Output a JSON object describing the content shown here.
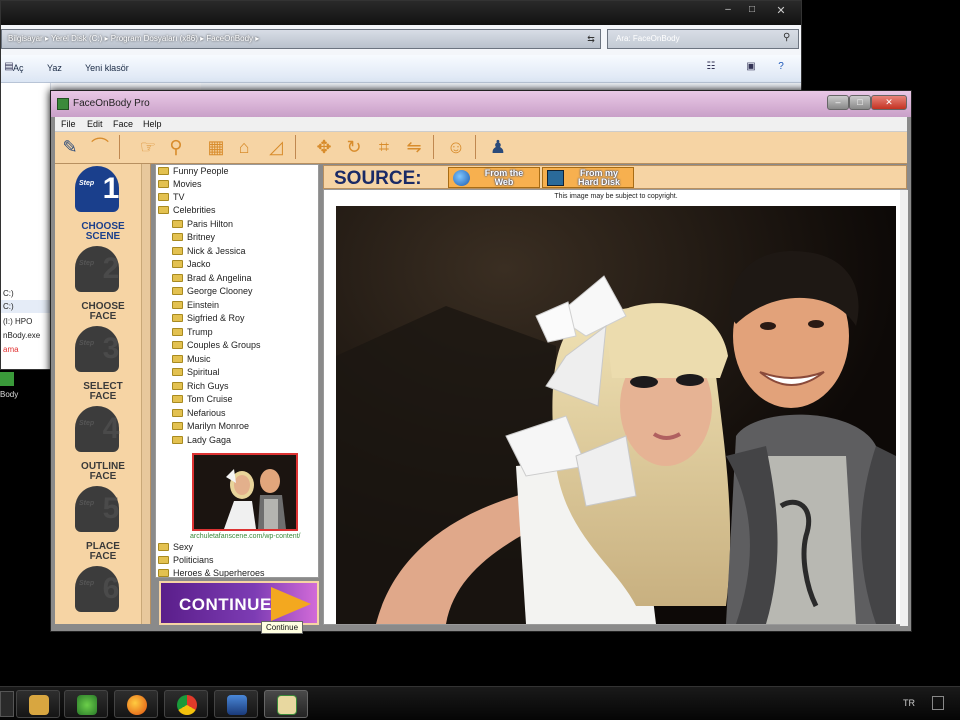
{
  "explorer": {
    "address_path": "Bilgisayar  ▸  Yerel Disk (C:)  ▸  Program Dosyaları (x86)  ▸  FaceOnBody  ▸",
    "search_placeholder": "Ara: FaceOnBody",
    "toolbar": [
      "Aç",
      "Yaz",
      "Yeni klasör"
    ],
    "nav_items": [
      "C:)",
      "C:)",
      "(I:) HPO",
      "nBody.exe",
      "ama"
    ],
    "desktop_label": "Body"
  },
  "app": {
    "title": "FaceOnBody Pro",
    "menu": [
      "File",
      "Edit",
      "Face",
      "Help"
    ],
    "steps": [
      {
        "word": "Step",
        "number": "1",
        "label_line1": "CHOOSE",
        "label_line2": "SCENE",
        "active": true
      },
      {
        "word": "Step",
        "number": "2",
        "label_line1": "CHOOSE",
        "label_line2": "FACE",
        "active": false
      },
      {
        "word": "Step",
        "number": "3",
        "label_line1": "SELECT",
        "label_line2": "FACE",
        "active": false
      },
      {
        "word": "Step",
        "number": "4",
        "label_line1": "OUTLINE",
        "label_line2": "FACE",
        "active": false
      },
      {
        "word": "Step",
        "number": "5",
        "label_line1": "PLACE",
        "label_line2": "FACE",
        "active": false
      },
      {
        "word": "Step",
        "number": "6",
        "label_line1": "",
        "label_line2": "",
        "active": false
      }
    ],
    "tree": {
      "top_level_before": [
        "Funny People",
        "Movies",
        "TV",
        "Celebrities"
      ],
      "celebrities": [
        "Paris Hilton",
        "Britney",
        "Nick & Jessica",
        "Jacko",
        "Brad & Angelina",
        "George Clooney",
        "Einstein",
        "Sigfried & Roy",
        "Trump",
        "Couples & Groups",
        "Music",
        "Spiritual",
        "Rich Guys",
        "Tom Cruise",
        "Nefarious",
        "Marilyn Monroe",
        "Lady Gaga"
      ],
      "thumbnail_credit": "archuletafanscene.com/wp-content/",
      "top_level_after": [
        "Sexy",
        "Politicians",
        "Heroes & Superheroes"
      ]
    },
    "continue_label": "CONTINUE",
    "tooltip": "Continue",
    "source": {
      "label": "SOURCE:",
      "web_line1": "From the",
      "web_line2": "Web",
      "disk_line1": "From my",
      "disk_line2": "Hard Disk"
    },
    "copyright_notice": "This image may be subject to copyright."
  },
  "taskbar": {
    "language": "TR"
  }
}
